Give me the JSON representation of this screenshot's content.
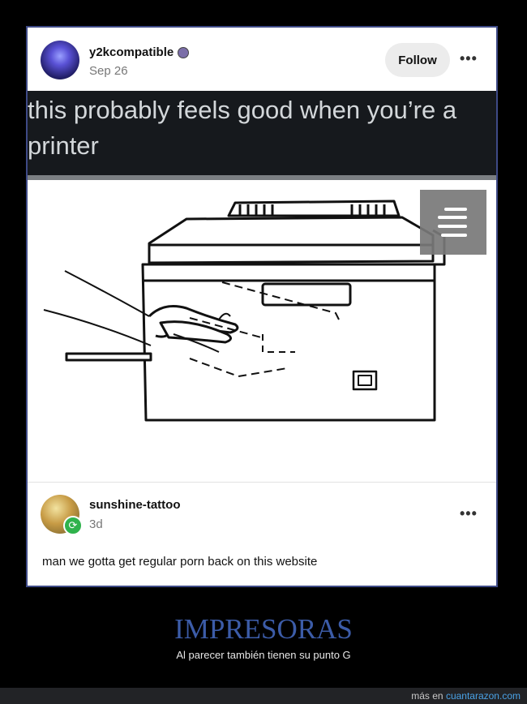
{
  "post": {
    "username": "y2kcompatible",
    "date": "Sep 26",
    "follow_label": "Follow",
    "more_label": "•••",
    "caption": "this probably feels good when you’re a printer",
    "image_icon": "printer-line-drawing-with-hand"
  },
  "reblog": {
    "username": "sunshine-tattoo",
    "date": "3d",
    "more_label": "•••",
    "comment": "man we gotta get regular porn back on this website",
    "badge_icon": "reblog-icon"
  },
  "meme": {
    "title": "IMPRESORAS",
    "subtitle": "Al parecer también tienen su punto G"
  },
  "footer": {
    "prefix": "más en ",
    "site": "cuantarazon.com"
  },
  "colors": {
    "title": "#3c5ca8",
    "frame_border": "#3e4a86",
    "reblog_badge": "#2fb24c",
    "link": "#4aa2e6"
  }
}
